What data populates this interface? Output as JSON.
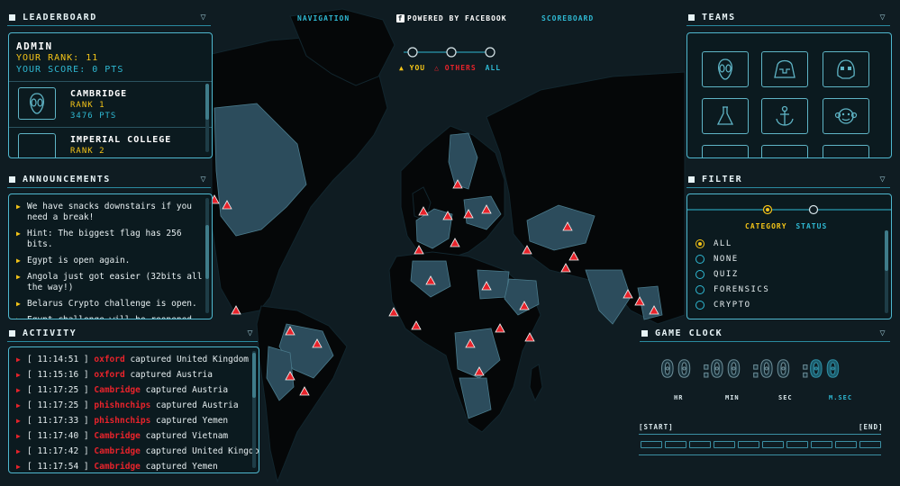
{
  "topnav": {
    "navigation": "NAVIGATION",
    "powered": "POWERED BY FACEBOOK",
    "scoreboard": "SCOREBOARD",
    "legend_you": "YOU",
    "legend_others": "OTHERS",
    "legend_all": "ALL"
  },
  "leaderboard": {
    "title": "LEADERBOARD",
    "user": {
      "name": "ADMIN",
      "rank": "YOUR RANK: 11",
      "score": "YOUR SCORE: 0 PTS"
    },
    "entries": [
      {
        "name": "CAMBRIDGE",
        "rank": "RANK 1",
        "points": "3476 PTS"
      },
      {
        "name": "IMPERIAL COLLEGE",
        "rank": "RANK 2"
      }
    ]
  },
  "announcements": {
    "title": "ANNOUNCEMENTS",
    "items": [
      "We have snacks downstairs if you need a break!",
      "Hint: The biggest flag has 256 bits.",
      "Egypt is open again.",
      "Angola just got easier (32bits all the way!)",
      "Belarus Crypto challenge is open.",
      "Egypt challenge will be reopened later. Work on something else for"
    ]
  },
  "activity": {
    "title": "ACTIVITY",
    "items": [
      {
        "time": "[ 11:14:51 ]",
        "team": "oxford",
        "verb": "captured",
        "country": "United Kingdom"
      },
      {
        "time": "[ 11:15:16 ]",
        "team": "oxford",
        "verb": "captured",
        "country": "Austria"
      },
      {
        "time": "[ 11:17:25 ]",
        "team": "Cambridge",
        "verb": "captured",
        "country": "Austria"
      },
      {
        "time": "[ 11:17:25 ]",
        "team": "phishnchips",
        "verb": "captured",
        "country": "Austria"
      },
      {
        "time": "[ 11:17:33 ]",
        "team": "phishnchips",
        "verb": "captured",
        "country": "Yemen"
      },
      {
        "time": "[ 11:17:40 ]",
        "team": "Cambridge",
        "verb": "captured",
        "country": "Vietnam"
      },
      {
        "time": "[ 11:17:42 ]",
        "team": "Cambridge",
        "verb": "captured",
        "country": "United Kingdom"
      },
      {
        "time": "[ 11:17:54 ]",
        "team": "Cambridge",
        "verb": "captured",
        "country": "Yemen"
      }
    ]
  },
  "teams": {
    "title": "TEAMS",
    "icons": [
      "alien-icon",
      "helmet-icon",
      "trooper-icon",
      "flask-icon",
      "anchor-icon",
      "monkey-icon"
    ]
  },
  "filter": {
    "title": "FILTER",
    "tab_category": "CATEGORY",
    "tab_status": "STATUS",
    "options": [
      "ALL",
      "NONE",
      "QUIZ",
      "FORENSICS",
      "CRYPTO"
    ],
    "selected": "ALL"
  },
  "game_clock": {
    "title": "GAME CLOCK",
    "hr": "00",
    "min": "00",
    "sec": "00",
    "msec": "00",
    "label_hr": "HR",
    "label_min": "MIN",
    "label_sec": "SEC",
    "label_msec": "M.SEC",
    "start": "[START]",
    "end": "[END]"
  },
  "colors": {
    "accent": "#2fb9d3",
    "you": "#f5c518",
    "others": "#e8232b",
    "land": "#050708",
    "land_captured": "#2c4c5c"
  }
}
